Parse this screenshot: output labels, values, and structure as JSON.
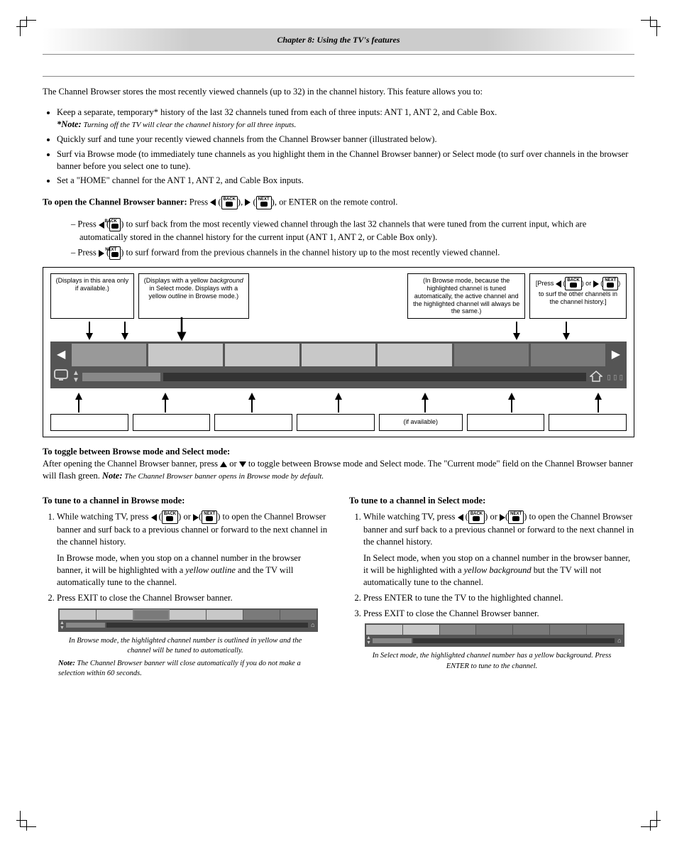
{
  "header": {
    "chapter": "Chapter 8: Using the TV's features"
  },
  "intro": "The Channel Browser stores the most recently viewed channels (up to 32) in the channel history. This feature allows you to:",
  "bullets": [
    "Keep a separate, temporary* history of the last 32 channels tuned from each of three inputs: ANT 1, ANT 2, and Cable Box.",
    "Quickly surf and tune your recently viewed channels from the Channel Browser banner (illustrated below).",
    "Surf via Browse mode (to immediately tune channels as you highlight them in the Channel Browser banner) or Select mode (to surf over channels in the browser banner before you select one to tune).",
    "Set a \"HOME\" channel for the ANT 1, ANT 2, and Cable Box inputs."
  ],
  "star_note": {
    "label": "*Note:",
    "text": " Turning off the TV will clear the channel history for all three inputs."
  },
  "open_banner": {
    "lead": "To open the Channel Browser banner:",
    "tail_a": " Press ",
    "tail_b": ", ",
    "tail_c": ", or ENTER on the remote control.",
    "sub1_a": "Press ",
    "sub1_b": " to surf back from the most recently viewed channel through the last 32 channels that were tuned from the current input, which are automatically stored in the channel history for the current input (ANT 1, ANT 2, or Cable Box only).",
    "sub2_a": "Press ",
    "sub2_b": " to surf forward from the previous channels in the channel history up to the most recently viewed channel."
  },
  "icons": {
    "back": "BACK",
    "next": "NEXT"
  },
  "diagram": {
    "callout_top": [
      "(Displays in this area only if available.)",
      "(Displays with a yellow background in Select mode. Displays with a yellow outline in Browse mode.)",
      "(In Browse mode, because the highlighted channel is tuned automatically, the active channel and the highlighted channel will always be the same.)",
      "[Press ◀ (BACK) or ▶ (NEXT) to surf the other channels in the channel history.]"
    ],
    "callout_bot_center": "(if available)"
  },
  "toggle": {
    "heading": "To toggle between Browse mode and Select mode:",
    "body_a": "After opening the Channel Browser banner, press ",
    "body_b": " or ",
    "body_c": " to toggle between Browse mode and Select mode.  The \"Current mode\" field on the Channel Browser banner will flash green.  ",
    "note_label": "Note:",
    "note_text": " The Channel Browser banner opens in Browse mode by default."
  },
  "col_left": {
    "heading": "To tune to a channel in Browse mode:",
    "step1_a": "While watching TV, press ",
    "step1_b": " or ",
    "step1_c": "  to open the Channel Browser banner and surf back to a previous channel or forward to the next channel in the channel history.",
    "step1_p2_a": "In Browse mode, when you stop on a channel number in the browser banner, it will be highlighted with a ",
    "step1_p2_em": "yellow outline",
    "step1_p2_b": " and the TV will automatically tune to the channel.",
    "step2": "Press EXIT to close the Channel Browser banner.",
    "caption": "In Browse mode, the highlighted channel number is outlined in yellow and the channel will be tuned to automatically.",
    "note_label": "Note:",
    "note_text": " The Channel Browser banner will close automatically if you do not make a selection within 60 seconds."
  },
  "col_right": {
    "heading": "To tune to a channel in Select mode:",
    "step1_a": "While watching TV, press ",
    "step1_b": " or ",
    "step1_c": "  to open the Channel Browser banner and surf back to a previous channel or forward to the next channel in the channel history.",
    "step1_p2_a": "In Select mode, when you stop on a channel number in the browser banner, it will be highlighted with a ",
    "step1_p2_em": "yellow background",
    "step1_p2_b": " but the TV will not automatically tune to the channel.",
    "step2": "Press ENTER to tune the TV to the highlighted channel.",
    "step3": "Press EXIT to close the Channel Browser banner.",
    "caption": "In Select mode, the highlighted channel number has a yellow background. Press ENTER to tune to the channel."
  }
}
